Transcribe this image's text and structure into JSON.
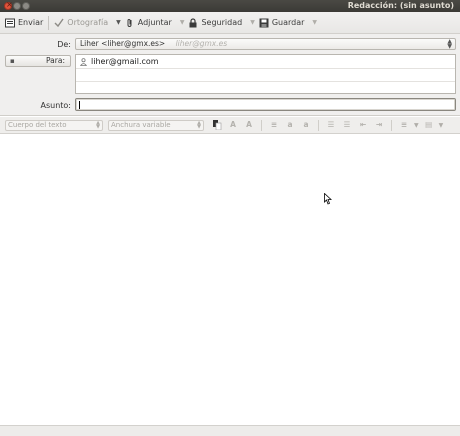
{
  "window": {
    "title": "Redacción: (sin asunto)"
  },
  "toolbar": {
    "send_label": "Enviar",
    "spelling_label": "Ortografía",
    "attach_label": "Adjuntar",
    "security_label": "Seguridad",
    "save_label": "Guardar"
  },
  "header": {
    "from_label": "De:",
    "from_value": "Liher <liher@gmx.es>",
    "from_hint": "liher@gmx.es",
    "to_label": "Para:",
    "to_value": "liher@gmail.com",
    "subject_label": "Asunto:",
    "subject_value": ""
  },
  "format": {
    "paragraph_style": "Cuerpo del texto",
    "font_family": "Anchura variable"
  },
  "colors": {
    "titlebar": "#3b3a36",
    "close_button": "#e0533b",
    "toolbar_bg": "#efeeec"
  }
}
